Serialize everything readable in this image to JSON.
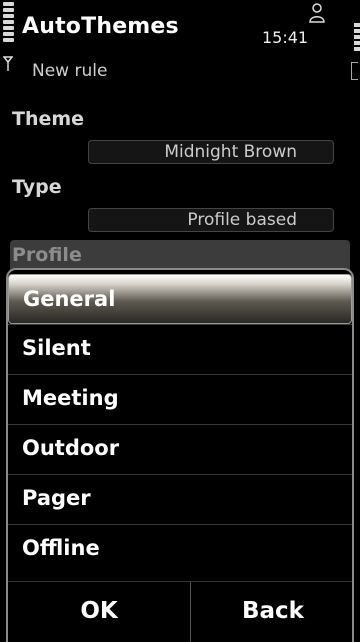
{
  "status_bar": {
    "app_title": "AutoThemes",
    "time": "15:41",
    "subtitle": "New rule"
  },
  "form": {
    "theme_label": "Theme",
    "theme_value": "Midnight Brown",
    "type_label": "Type",
    "type_value": "Profile based",
    "profile_label": "Profile"
  },
  "popup": {
    "items": [
      "General",
      "Silent",
      "Meeting",
      "Outdoor",
      "Pager",
      "Offline"
    ],
    "selected_index": 0,
    "ok_label": "OK",
    "back_label": "Back"
  },
  "colors": {
    "background": "#000000",
    "text": "#ffffff",
    "highlight_top": "#ffffff",
    "highlight_bottom": "#2a2824"
  }
}
